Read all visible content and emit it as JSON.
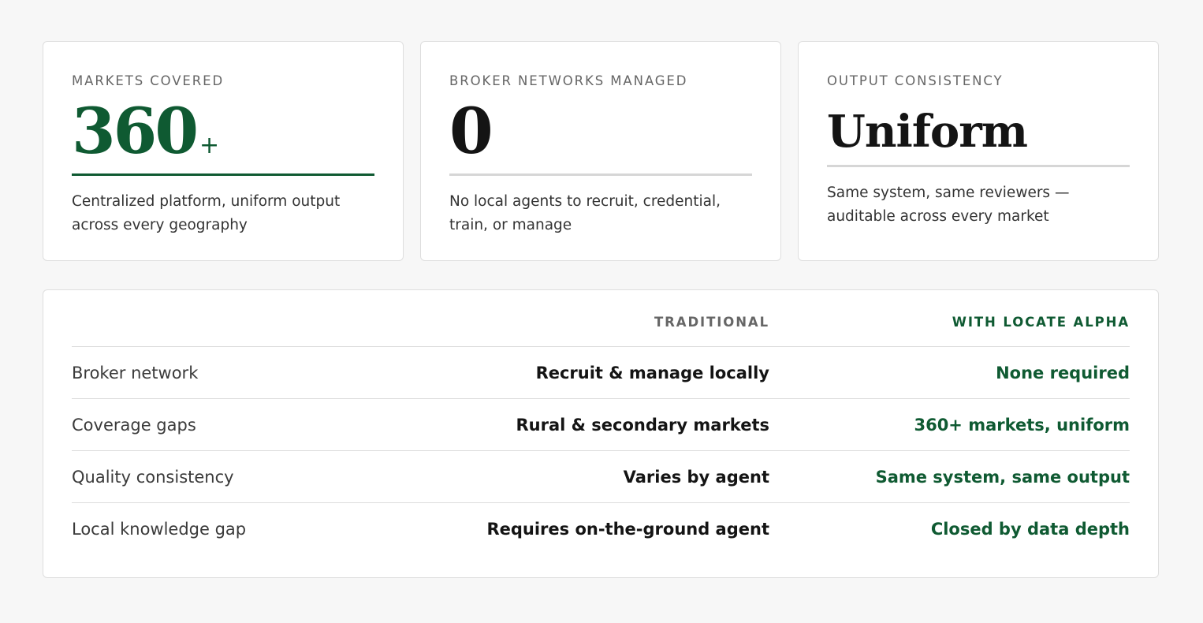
{
  "cards": [
    {
      "label": "MARKETS COVERED",
      "value": "360",
      "suffix": "+",
      "description": "Centralized platform, uniform output across every geography"
    },
    {
      "label": "BROKER NETWORKS MANAGED",
      "value": "0",
      "description": "No local agents to recruit, credential, train, or manage"
    },
    {
      "label": "OUTPUT CONSISTENCY",
      "value": "Uniform",
      "description": "Same system, same reviewers — auditable across every market"
    }
  ],
  "comparison": {
    "headers": {
      "traditional": "TRADITIONAL",
      "locate_alpha": "WITH LOCATE ALPHA"
    },
    "rows": [
      {
        "label": "Broker network",
        "traditional": "Recruit & manage locally",
        "locate_alpha": "None required"
      },
      {
        "label": "Coverage gaps",
        "traditional": "Rural & secondary markets",
        "locate_alpha": "360+ markets, uniform"
      },
      {
        "label": "Quality consistency",
        "traditional": "Varies by agent",
        "locate_alpha": "Same system, same output"
      },
      {
        "label": "Local knowledge gap",
        "traditional": "Requires on-the-ground agent",
        "locate_alpha": "Closed by data depth"
      }
    ]
  },
  "colors": {
    "accent": "#0f5a32",
    "background": "#f7f7f7",
    "card": "#ffffff"
  }
}
